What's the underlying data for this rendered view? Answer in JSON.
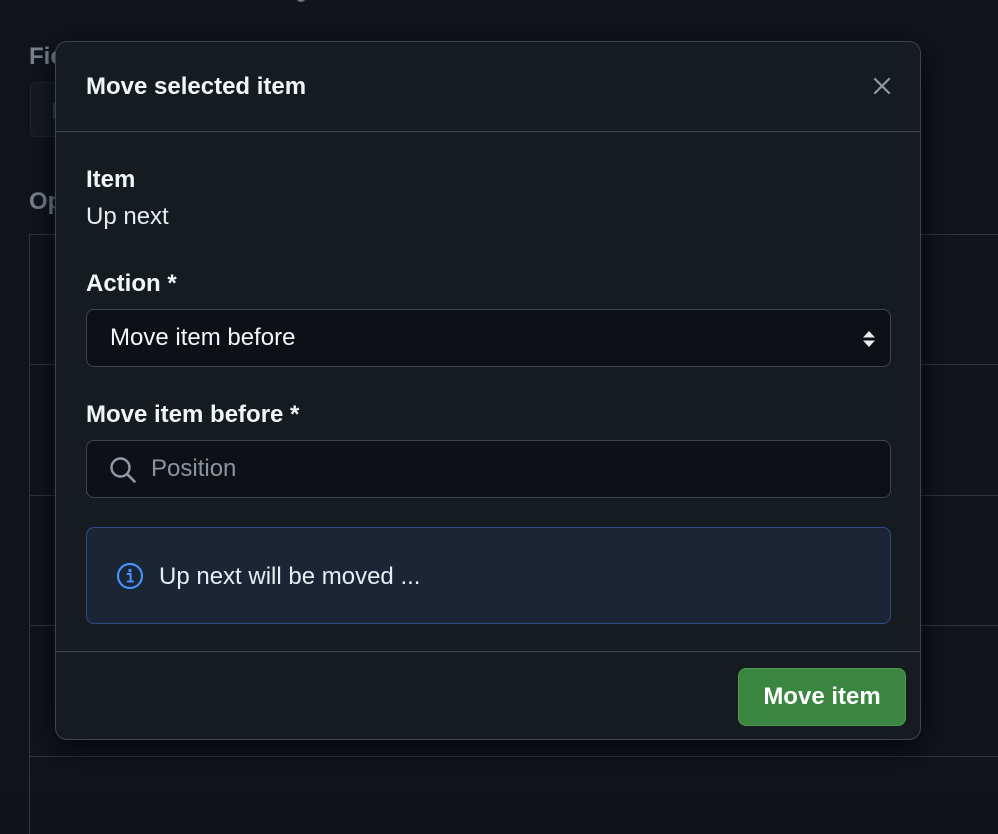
{
  "background": {
    "fields_label": "Fie",
    "options_label": "Op"
  },
  "dialog": {
    "title": "Move selected item",
    "close_icon": "close-icon",
    "item_label": "Item",
    "item_value": "Up next",
    "action_label": "Action *",
    "action_selected": "Move item before",
    "target_label": "Move item before *",
    "target_placeholder": "Position",
    "target_value": "",
    "info_icon": "info-icon",
    "info_text": "Up next will be moved ...",
    "submit_label": "Move item"
  },
  "colors": {
    "primary_button": "#3a8540",
    "info_background": "#1c2536",
    "info_border": "#2d4c84",
    "info_icon": "#4493f8"
  }
}
